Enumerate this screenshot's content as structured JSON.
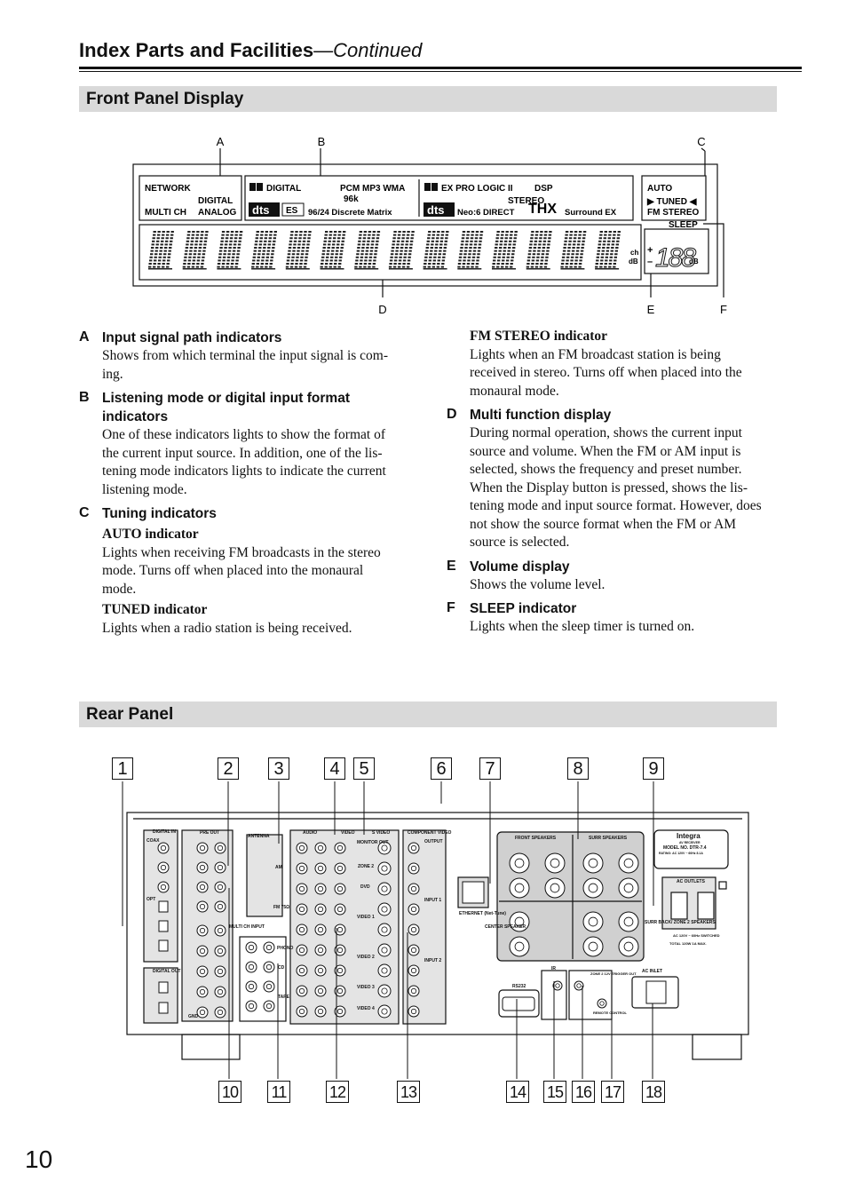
{
  "header": {
    "title": "Index Parts and Facilities",
    "continued": "—Continued"
  },
  "front_section": {
    "title": "Front Panel Display"
  },
  "rear_section": {
    "title": "Rear Panel"
  },
  "page_number": "10",
  "front_display": {
    "callouts": [
      "A",
      "B",
      "C",
      "D",
      "E",
      "F"
    ],
    "a_labels": {
      "network": "NETWORK",
      "digital": "DIGITAL",
      "multich": "MULTI CH",
      "analog": "ANALOG"
    },
    "b_labels": {
      "dd_digital": "DIGITAL",
      "pcm": "PCM  MP3  WMA",
      "k96": "96k",
      "dts": "dts",
      "es": "ES",
      "discrete": "96/24 Discrete Matrix",
      "dd_ex": "EX PRO LOGIC II",
      "dsp": "DSP",
      "stereo": "STEREO",
      "dts2": "dts",
      "neo": "Neo:6 DIRECT",
      "thx": "THX",
      "surround_ex": "Surround EX"
    },
    "c_labels": {
      "auto": "AUTO",
      "tuned": "▶ TUNED ◀",
      "fmstereo": "FM STEREO",
      "sleep": "SLEEP"
    },
    "d_units": {
      "ch": "ch",
      "db": "dB"
    },
    "e_labels": {
      "plus": "+",
      "minus": "–",
      "digits": "188",
      "db": "dB"
    }
  },
  "descriptions": {
    "a": {
      "letter": "A",
      "title": "Input signal path indicators",
      "text": "Shows from which terminal the input signal is com-ing."
    },
    "b": {
      "letter": "B",
      "title": "Listening mode or digital input format indicators",
      "text": "One of these indicators lights to show the format of the current input source. In addition, one of the lis-tening mode indicators lights to indicate the current listening mode."
    },
    "c": {
      "letter": "C",
      "title": "Tuning indicators",
      "auto_title": "AUTO indicator",
      "auto_text": "Lights when receiving FM broadcasts in the stereo mode. Turns off when placed into the monaural mode.",
      "tuned_title": "TUNED indicator",
      "tuned_text": "Lights when a radio station is being received.",
      "fm_title": "FM STEREO indicator",
      "fm_text": "Lights when an FM broadcast station is being received in stereo. Turns off when placed into the monaural mode."
    },
    "d": {
      "letter": "D",
      "title": "Multi function display",
      "text": "During normal operation, shows the current input source and volume. When the FM or AM input is selected, shows the frequency and preset number. When the Display button is pressed, shows the lis-tening mode and input source format. However, does not show the source format when the FM or AM source is selected."
    },
    "e": {
      "letter": "E",
      "title": "Volume display",
      "text": "Shows the volume level."
    },
    "f": {
      "letter": "F",
      "title": "SLEEP indicator",
      "text": "Lights when the sleep timer is turned on."
    }
  },
  "rear_panel": {
    "callouts_top": [
      "1",
      "2",
      "3",
      "4",
      "5",
      "6",
      "7",
      "8",
      "9"
    ],
    "callouts_bottom": [
      "10",
      "11",
      "12",
      "13",
      "14",
      "15",
      "16",
      "17",
      "18"
    ],
    "labels": {
      "digital_in": "DIGITAL IN",
      "coax": "COAX",
      "opt": "OPT",
      "digital_out": "DIGITAL OUT",
      "pre_out": "PRE OUT",
      "multi_ch_input": "MULTI CH INPUT",
      "antenna": "ANTENNA",
      "am": "AM",
      "fm": "FM 75Ω",
      "audio": "AUDIO",
      "video": "VIDEO",
      "s_video": "S VIDEO",
      "monitor_out": "MONITOR OUT",
      "zone2": "ZONE 2",
      "dvd": "DVD",
      "video1": "VIDEO 1",
      "video2": "VIDEO 2",
      "video3": "VIDEO 3",
      "video4": "VIDEO 4",
      "tape": "TAPE",
      "phono": "PHONO",
      "cd": "CD",
      "gnd": "GND",
      "component_video": "COMPONENT VIDEO",
      "output": "OUTPUT",
      "input1": "INPUT 1",
      "input2": "INPUT 2",
      "ethernet": "ETHERNET (Net-Tune)",
      "front_speakers": "FRONT SPEAKERS",
      "surr_speakers": "SURR SPEAKERS",
      "center_speaker": "CENTER SPEAKER",
      "surr_back": "SURR BACK/ ZONE 2 SPEAKERS",
      "r": "R",
      "l": "L",
      "plus": "+",
      "minus": "–",
      "brand": "Integra",
      "av_receiver": "AV RECEIVER",
      "model": "MODEL NO. DTR-7.4",
      "rating": "RATING: AC 120V ~  60Hz 8.1A",
      "ac_outlets": "AC OUTLETS",
      "switched": "AC 120V ~ 60Hz SWITCHED",
      "total": "TOTAL 120W 1A MAX.",
      "rs232": "RS232",
      "ir": "IR",
      "in": "IN",
      "out": "OUT",
      "zone2_12v": "ZONE 2 12V TRIGGER OUT",
      "remote_control": "REMOTE CONTROL",
      "ac_inlet": "AC INLET"
    }
  }
}
